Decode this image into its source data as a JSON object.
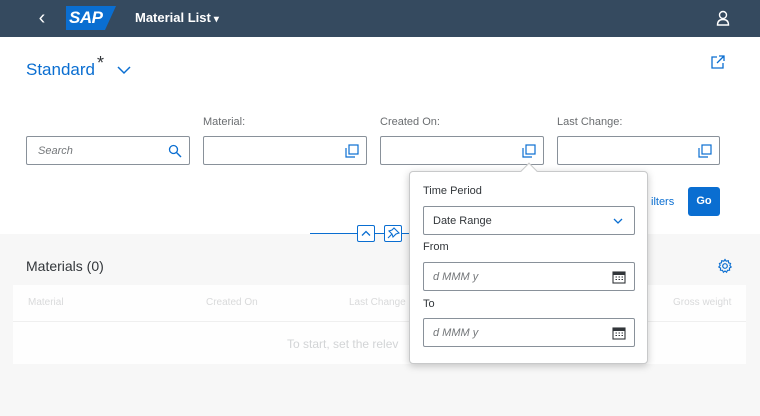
{
  "shell": {
    "logo_text": "SAP",
    "app_title": "Material List",
    "title_caret": "▾",
    "back_glyph": "‹"
  },
  "variant": {
    "name": "Standard",
    "modified_marker": "*",
    "chevron": "⌵"
  },
  "filters": {
    "search_placeholder": "Search",
    "material_label": "Material:",
    "created_on_label": "Created On:",
    "last_change_label": "Last Change:",
    "adapt_filters_partial": "ilters",
    "go_label": "Go"
  },
  "materials": {
    "title": "Materials (0)",
    "columns": [
      "Material",
      "Created On",
      "Last Change",
      "Gross weight"
    ],
    "no_data_partial": "To start, set the relev"
  },
  "popover": {
    "time_period_label": "Time Period",
    "time_period_value": "Date Range",
    "from_label": "From",
    "from_placeholder": "d MMM y",
    "to_label": "To",
    "to_placeholder": "d MMM y"
  },
  "colors": {
    "shell_bg": "#354a5f",
    "brand_blue": "#0a6ed1",
    "page_bg": "#f7f7f7"
  }
}
